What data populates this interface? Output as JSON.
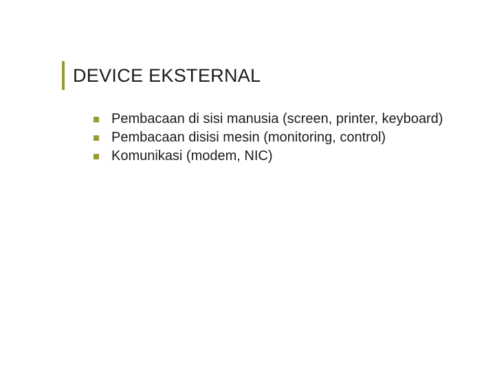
{
  "slide": {
    "title": "DEVICE EKSTERNAL",
    "bullets": [
      "Pembacaan di sisi manusia (screen, printer, keyboard)",
      "Pembacaan disisi mesin (monitoring, control)",
      "Komunikasi (modem, NIC)"
    ]
  }
}
